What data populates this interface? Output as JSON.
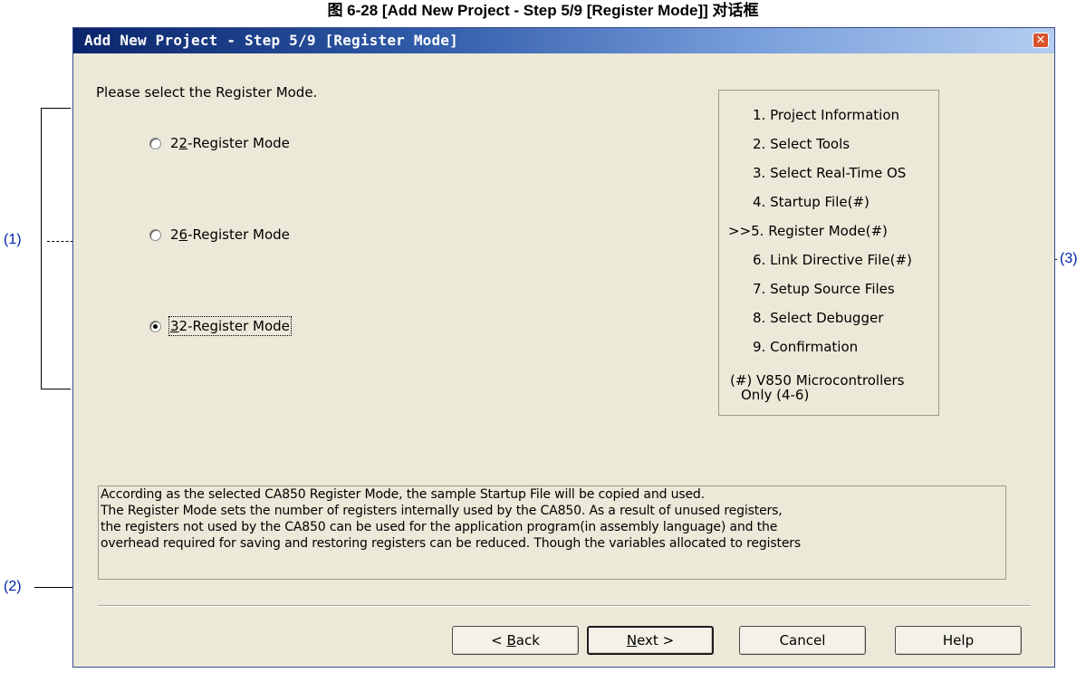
{
  "figure_caption": "图 6-28 [Add New Project - Step 5/9 [Register Mode]] 对话框",
  "dialog": {
    "title": "Add New Project - Step 5/9 [Register Mode]",
    "prompt": "Please select the Register Mode.",
    "options": [
      {
        "prefix": "2",
        "mnemonic": "2",
        "rest": "-Register Mode",
        "selected": false
      },
      {
        "prefix": "2",
        "mnemonic": "6",
        "rest": "-Register Mode",
        "selected": false
      },
      {
        "prefix": "",
        "mnemonic": "3",
        "rest": "2-Register Mode",
        "selected": true
      }
    ],
    "steps": [
      "1. Project Information",
      "2. Select Tools",
      "3. Select Real-Time OS",
      "4. Startup File(#)",
      ">>5. Register Mode(#)",
      "6. Link Directive File(#)",
      "7. Setup Source Files",
      "8. Select Debugger",
      "9. Confirmation"
    ],
    "note_line1": "(#) V850 Microcontrollers",
    "note_line2": "Only (4-6)",
    "description": [
      "According as the selected CA850 Register Mode, the sample Startup File will be copied and used.",
      "The Register Mode sets the number of registers internally used by the CA850. As a result of unused registers,",
      "the registers not used by the CA850 can be used for the application program(in assembly language) and the",
      "overhead required for saving and restoring registers can be reduced. Though the variables allocated to registers"
    ],
    "buttons": {
      "back_prefix": "< ",
      "back_mnemonic": "B",
      "back_rest": "ack",
      "next_mnemonic": "N",
      "next_rest": "ext >",
      "cancel": "Cancel",
      "help": "Help"
    }
  },
  "annotations": {
    "a1": "(1)",
    "a2": "(2)",
    "a3": "(3)"
  },
  "colors": {
    "titlebar_start": "#0a246a",
    "window_bg": "#ece9d8",
    "annotation": "#0022aa"
  }
}
